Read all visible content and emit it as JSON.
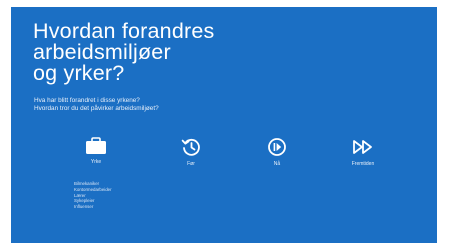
{
  "slide": {
    "title_lines": [
      "Hvordan forandres",
      "arbeidsmiljøer",
      "og yrker?"
    ],
    "subtitle_lines": [
      "Hva har blitt forandret i disse yrkene?",
      "Hvordan tror du det påvirker arbeidsmiljøet?"
    ],
    "columns": [
      {
        "icon": "briefcase-icon",
        "label": "Yrke"
      },
      {
        "icon": "history-clock-icon",
        "label": "Før"
      },
      {
        "icon": "play-circle-icon",
        "label": "Nå"
      },
      {
        "icon": "fast-forward-icon",
        "label": "Fremtiden"
      }
    ],
    "occupations": [
      "Bilmekaniker",
      "Kontormedarbeider",
      "Lærer",
      "Sykepleier",
      "Influenser"
    ]
  },
  "colors": {
    "slide_background": "#1b6fc4",
    "text": "#ffffff"
  }
}
